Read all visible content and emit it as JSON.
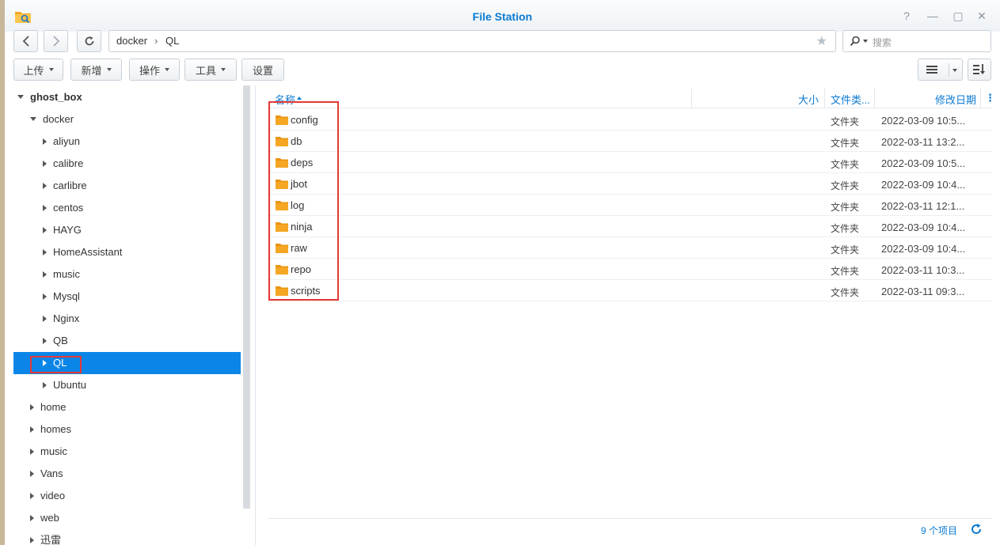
{
  "window": {
    "title": "File Station"
  },
  "title_buttons": {
    "help": "?",
    "minimize": "—",
    "maximize": "▢",
    "close": "✕"
  },
  "address": {
    "path": [
      "docker",
      "QL"
    ],
    "separator": "›"
  },
  "search": {
    "placeholder": "搜索"
  },
  "toolbar": {
    "upload": "上传",
    "create": "新增",
    "action": "操作",
    "tools": "工具",
    "settings": "设置"
  },
  "tree": [
    {
      "label": "ghost_box",
      "state": "expanded",
      "bold": true
    },
    {
      "label": "docker",
      "state": "expanded"
    },
    {
      "label": "aliyun",
      "state": "collapsed"
    },
    {
      "label": "calibre",
      "state": "collapsed"
    },
    {
      "label": "carlibre",
      "state": "collapsed"
    },
    {
      "label": "centos",
      "state": "collapsed"
    },
    {
      "label": "HAYG",
      "state": "collapsed"
    },
    {
      "label": "HomeAssistant",
      "state": "collapsed"
    },
    {
      "label": "music",
      "state": "collapsed"
    },
    {
      "label": "Mysql",
      "state": "collapsed"
    },
    {
      "label": "Nginx",
      "state": "collapsed"
    },
    {
      "label": "QB",
      "state": "collapsed"
    },
    {
      "label": "QL",
      "state": "collapsed",
      "selected": true
    },
    {
      "label": "Ubuntu",
      "state": "collapsed"
    },
    {
      "label": "home",
      "state": "collapsed"
    },
    {
      "label": "homes",
      "state": "collapsed"
    },
    {
      "label": "music",
      "state": "collapsed"
    },
    {
      "label": "Vans",
      "state": "collapsed"
    },
    {
      "label": "video",
      "state": "collapsed"
    },
    {
      "label": "web",
      "state": "collapsed"
    },
    {
      "label": "迅雷",
      "state": "collapsed"
    }
  ],
  "columns": {
    "name": "名称",
    "size": "大小",
    "type": "文件类...",
    "modified": "修改日期",
    "more": "⋮"
  },
  "files": [
    {
      "name": "config",
      "type": "文件夹",
      "modified": "2022-03-09 10:5..."
    },
    {
      "name": "db",
      "type": "文件夹",
      "modified": "2022-03-11 13:2..."
    },
    {
      "name": "deps",
      "type": "文件夹",
      "modified": "2022-03-09 10:5..."
    },
    {
      "name": "jbot",
      "type": "文件夹",
      "modified": "2022-03-09 10:4..."
    },
    {
      "name": "log",
      "type": "文件夹",
      "modified": "2022-03-11 12:1..."
    },
    {
      "name": "ninja",
      "type": "文件夹",
      "modified": "2022-03-09 10:4..."
    },
    {
      "name": "raw",
      "type": "文件夹",
      "modified": "2022-03-09 10:4..."
    },
    {
      "name": "repo",
      "type": "文件夹",
      "modified": "2022-03-11 10:3..."
    },
    {
      "name": "scripts",
      "type": "文件夹",
      "modified": "2022-03-11 09:3..."
    }
  ],
  "footer": {
    "count": "9 个项目"
  },
  "colors": {
    "accent": "#0b7ad1",
    "selection": "#0b86e8",
    "folder": "#f5a623",
    "highlight": "#e53935"
  }
}
